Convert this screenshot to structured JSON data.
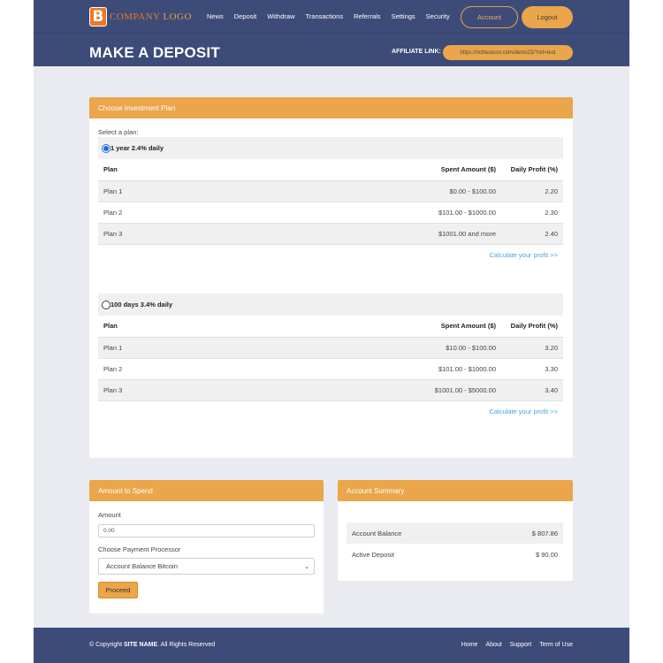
{
  "header": {
    "logo_letter": "B",
    "logo_company": "COMPANY",
    "logo_word": "LOGO",
    "nav": [
      "News",
      "Deposit",
      "Withdraw",
      "Transactions",
      "Referrals",
      "Settings",
      "Security"
    ],
    "account_label": "Account",
    "logout_label": "Logout",
    "page_title": "MAKE A DEPOSIT",
    "affiliate_label": "AFFILIATE LINK:",
    "affiliate_url": "https://richlexicon.com/demo23/?ref=test"
  },
  "plans_panel": {
    "title": "Choose Investment Plan",
    "select_label": "Select a plan:",
    "plans": [
      {
        "name": "1 year 2.4% daily",
        "selected": true,
        "headers": [
          "Plan",
          "Spent Amount ($)",
          "Daily Profit (%)"
        ],
        "rows": [
          [
            "Plan 1",
            "$0.00 - $100.00",
            "2.20"
          ],
          [
            "Plan 2",
            "$101.00 - $1000.00",
            "2.30"
          ],
          [
            "Plan 3",
            "$1001.00 and more",
            "2.40"
          ]
        ],
        "calc_link": "Calculate your profit >>"
      },
      {
        "name": "100 days 3.4% daily",
        "selected": false,
        "headers": [
          "Plan",
          "Spent Amount ($)",
          "Daily Profit (%)"
        ],
        "rows": [
          [
            "Plan 1",
            "$10.00 - $100.00",
            "3.20"
          ],
          [
            "Plan 2",
            "$101.00 - $1000.00",
            "3.30"
          ],
          [
            "Plan 3",
            "$1001.00 - $5000.00",
            "3.40"
          ]
        ],
        "calc_link": "Calculate your profit >>"
      }
    ]
  },
  "amount_panel": {
    "title": "Amount to Spend",
    "amount_label": "Amount",
    "amount_value": "0.00",
    "processor_label": "Choose Payment Processor",
    "processor_selected": "Account Balance Bitcoin",
    "proceed_label": "Proceed"
  },
  "summary_panel": {
    "title": "Account Summary",
    "rows": [
      [
        "Account Balance",
        "$ 807.86"
      ],
      [
        "Active Deposit",
        "$ 90.00"
      ]
    ]
  },
  "footer": {
    "copyright_prefix": "© Copyright",
    "site_name": "SITE NAME",
    "copyright_suffix": ". All Rights Reserved",
    "links": [
      "Home",
      "About",
      "Support",
      "Term of Use"
    ]
  },
  "colors": {
    "header_bg": "#3d4b78",
    "accent": "#eba54a",
    "link": "#4aa3df",
    "radio_selected": "#1f6fd6"
  }
}
